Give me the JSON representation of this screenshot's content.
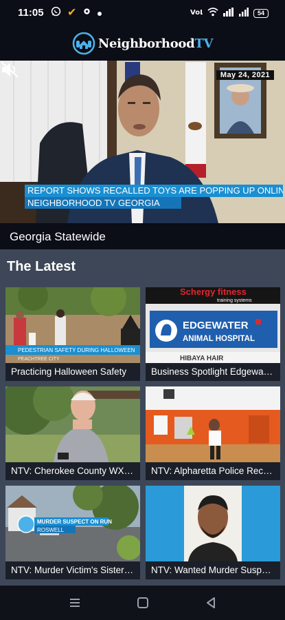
{
  "status": {
    "time": "11:05",
    "battery": "54",
    "network": "4G"
  },
  "app": {
    "logo_name": "Neighborhood",
    "logo_tv": "TV"
  },
  "video": {
    "date": "May 24, 2021",
    "ticker_headline": "REPORT SHOWS RECALLED TOYS ARE POPPING UP ONLINE",
    "ticker_station": "NEIGHBORHOOD TV GEORGIA",
    "channel": "Georgia Statewide",
    "muted": true
  },
  "latest": {
    "title": "The Latest",
    "cards": [
      {
        "caption": "Practicing Halloween Safety",
        "overlay": "PEDESTRIAN SAFETY DURING HALLOWEEN",
        "overlay_sub": "PEACHTREE CITY"
      },
      {
        "caption": "Business Spotlight Edgewater Animal Hospital",
        "sign_top": "Schergy fitness",
        "sign_sub": "training systems",
        "sign_main": "EDGEWATER",
        "sign_main2": "ANIMAL HOSPITAL",
        "sign_bottom": "HIBAYA HAIR"
      },
      {
        "caption": "NTV: Cherokee County WX Damage"
      },
      {
        "caption": "NTV: Alpharetta Police Recruitment"
      },
      {
        "caption": "NTV: Murder Victim's Sister Speaks",
        "overlay": "MURDER SUSPECT ON RUN",
        "overlay_sub": "ROSWELL"
      },
      {
        "caption": "NTV: Wanted Murder Suspect Caught"
      }
    ]
  }
}
